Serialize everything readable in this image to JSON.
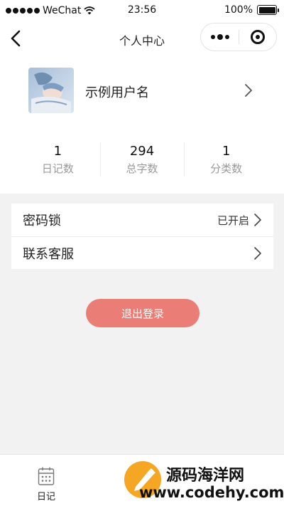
{
  "status_bar": {
    "carrier": "WeChat",
    "time": "23:56",
    "battery": "100%",
    "battery_level": 1.0
  },
  "nav": {
    "title": "个人中心"
  },
  "profile": {
    "username": "示例用户名",
    "stats": [
      {
        "value": "1",
        "label": "日记数"
      },
      {
        "value": "294",
        "label": "总字数"
      },
      {
        "value": "1",
        "label": "分类数"
      }
    ]
  },
  "menu": {
    "items": [
      {
        "label": "密码锁",
        "value": "已开启"
      },
      {
        "label": "联系客服",
        "value": ""
      }
    ]
  },
  "logout_label": "退出登录",
  "tabbar": {
    "tabs": [
      {
        "label": "日记"
      }
    ]
  },
  "watermark": {
    "title": "源码海洋网",
    "url": "www.codehy.com"
  },
  "colors": {
    "accent": "#ea7d75",
    "background": "#f2f2f2",
    "watermark_logo": "#f5a623"
  },
  "icons": {
    "back": "chevron-left-icon",
    "more": "more-dots-icon",
    "close": "target-close-icon",
    "arrow": "chevron-right-icon",
    "diary": "calendar-icon"
  }
}
